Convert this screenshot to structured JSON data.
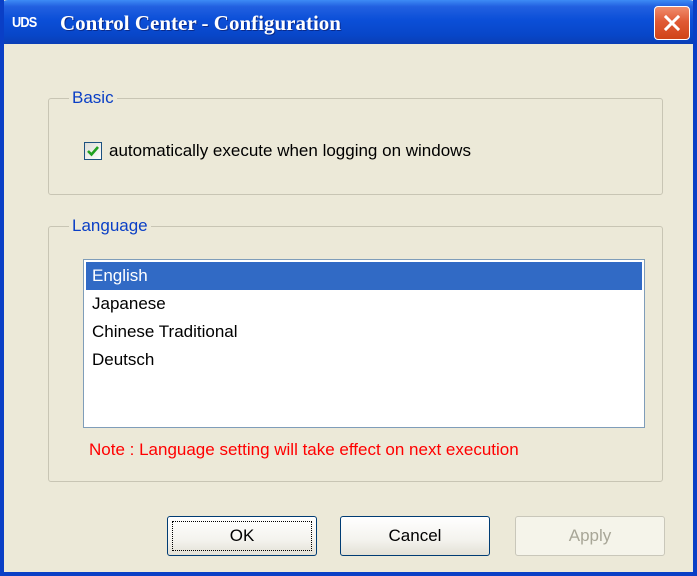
{
  "window": {
    "icon_text": "UDS",
    "title": "Control Center - Configuration"
  },
  "basic": {
    "legend": "Basic",
    "auto_execute_label": "automatically execute when logging on windows",
    "auto_execute_checked": true
  },
  "language": {
    "legend": "Language",
    "items": [
      "English",
      "Japanese",
      "Chinese Traditional",
      "Deutsch"
    ],
    "selected": "English",
    "note": "Note : Language setting will take effect on next execution"
  },
  "buttons": {
    "ok": "OK",
    "cancel": "Cancel",
    "apply": "Apply"
  },
  "colors": {
    "titlebar": "#0846c8",
    "selection": "#316ac5",
    "legend_text": "#0a3fc6",
    "note_text": "#ff0000",
    "close_button": "#e05a35",
    "checkmark": "#21a121"
  },
  "icons": {
    "close": "close-icon",
    "check": "checkmark-icon"
  }
}
